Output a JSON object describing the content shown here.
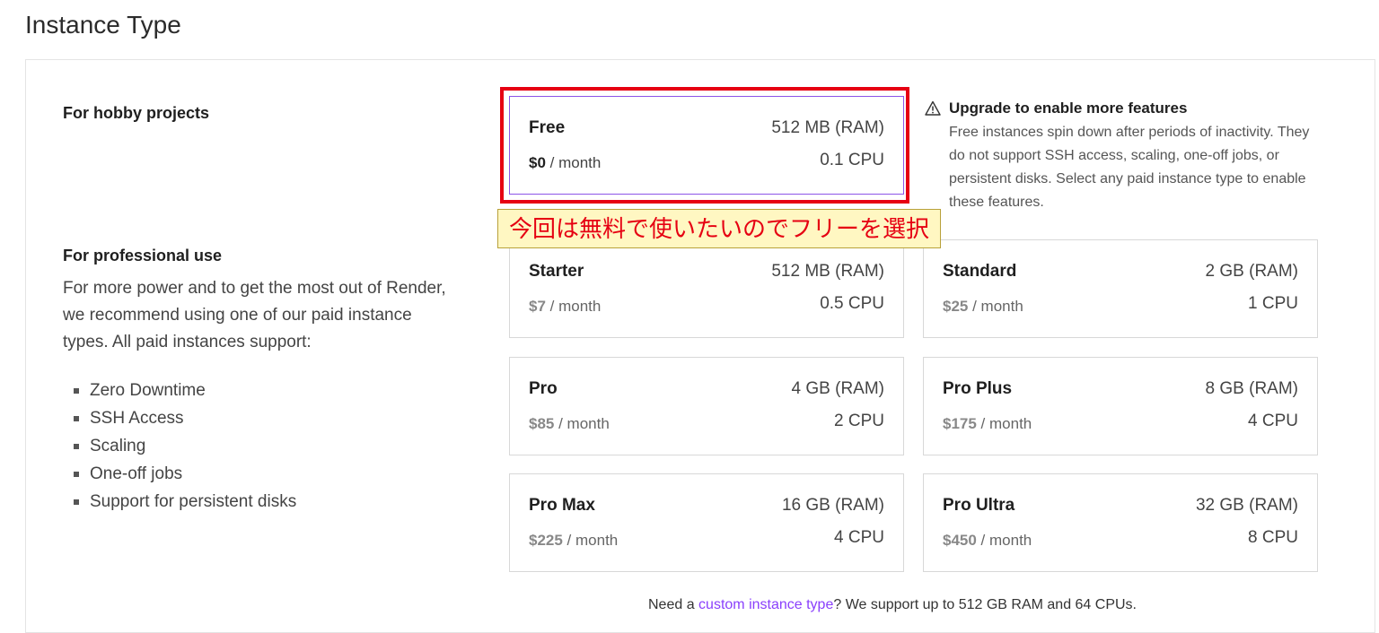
{
  "page": {
    "title": "Instance Type"
  },
  "hobby": {
    "title": "For hobby projects"
  },
  "professional": {
    "title": "For professional use",
    "description": "For more power and to get the most out of Render, we recommend using one of our paid instance types. All paid instances support:",
    "features": [
      "Zero Downtime",
      "SSH Access",
      "Scaling",
      "One-off jobs",
      "Support for persistent disks"
    ]
  },
  "instances": {
    "free": {
      "name": "Free",
      "ram": "512 MB (RAM)",
      "cpu": "0.1 CPU",
      "price": "$0",
      "per": " / month",
      "selected": true
    },
    "starter": {
      "name": "Starter",
      "ram": "512 MB (RAM)",
      "cpu": "0.5 CPU",
      "price": "$7",
      "per": " / month"
    },
    "standard": {
      "name": "Standard",
      "ram": "2 GB (RAM)",
      "cpu": "1 CPU",
      "price": "$25",
      "per": " / month"
    },
    "pro": {
      "name": "Pro",
      "ram": "4 GB (RAM)",
      "cpu": "2 CPU",
      "price": "$85",
      "per": " / month"
    },
    "pro_plus": {
      "name": "Pro Plus",
      "ram": "8 GB (RAM)",
      "cpu": "4 CPU",
      "price": "$175",
      "per": " / month"
    },
    "pro_max": {
      "name": "Pro Max",
      "ram": "16 GB (RAM)",
      "cpu": "4 CPU",
      "price": "$225",
      "per": " / month"
    },
    "pro_ultra": {
      "name": "Pro Ultra",
      "ram": "32 GB (RAM)",
      "cpu": "8 CPU",
      "price": "$450",
      "per": " / month"
    }
  },
  "warning": {
    "icon": "warning-triangle-icon",
    "title": "Upgrade to enable more features",
    "body": "Free instances spin down after periods of inactivity. They do not support SSH access, scaling, one-off jobs, or persistent disks. Select any paid instance type to enable these features."
  },
  "annotation": {
    "text": "今回は無料で使いたいのでフリーを選択"
  },
  "footer": {
    "prefix": "Need a ",
    "link": "custom instance type",
    "suffix": "? We support up to 512 GB RAM and 64 CPUs."
  },
  "colors": {
    "accent": "#8a3ffc",
    "highlight": "#e60012",
    "annotation_bg": "#fff7c2"
  }
}
